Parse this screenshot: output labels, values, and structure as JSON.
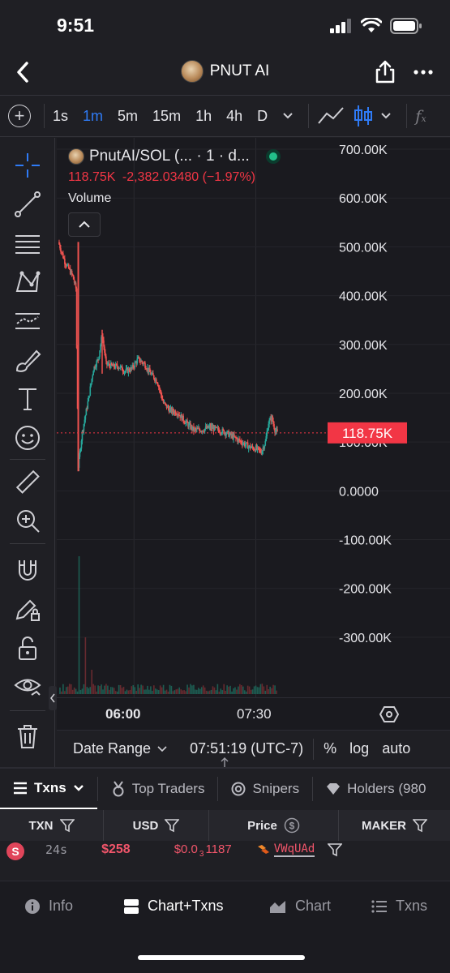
{
  "status": {
    "time": "9:51"
  },
  "nav": {
    "title": "PNUT AI"
  },
  "toolbar": {
    "intervals": [
      "1s",
      "1m",
      "5m",
      "15m",
      "1h",
      "4h",
      "D"
    ],
    "active_interval": "1m"
  },
  "legend": {
    "symbol": "PnutAI/SOL (... · 1 · d...",
    "price": "118.75K",
    "change": "-2,382.03480 (−1.97%)",
    "volume_label": "Volume"
  },
  "chart_data": {
    "type": "candlestick",
    "title": "PnutAI/SOL",
    "y_ticks": [
      "700.00K",
      "600.00K",
      "500.00K",
      "400.00K",
      "300.00K",
      "200.00K",
      "100.00K",
      "0.0000",
      "-100.00K",
      "-200.00K",
      "-300.00K"
    ],
    "ylim": [
      -350000,
      710000
    ],
    "x_ticks": [
      "06:00",
      "07:30"
    ],
    "last_price": 118750,
    "last_price_label": "118.75K",
    "price_path": [
      [
        0,
        510000
      ],
      [
        8,
        470000
      ],
      [
        18,
        440000
      ],
      [
        22,
        415000
      ],
      [
        25,
        50000
      ],
      [
        30,
        120000
      ],
      [
        38,
        190000
      ],
      [
        44,
        250000
      ],
      [
        50,
        270000
      ],
      [
        55,
        320000
      ],
      [
        60,
        260000
      ],
      [
        68,
        255000
      ],
      [
        76,
        255000
      ],
      [
        84,
        245000
      ],
      [
        92,
        250000
      ],
      [
        100,
        270000
      ],
      [
        108,
        260000
      ],
      [
        116,
        240000
      ],
      [
        124,
        225000
      ],
      [
        132,
        180000
      ],
      [
        140,
        165000
      ],
      [
        150,
        160000
      ],
      [
        160,
        140000
      ],
      [
        170,
        125000
      ],
      [
        180,
        125000
      ],
      [
        190,
        130000
      ],
      [
        200,
        125000
      ],
      [
        210,
        120000
      ],
      [
        220,
        110000
      ],
      [
        230,
        100000
      ],
      [
        240,
        90000
      ],
      [
        250,
        85000
      ],
      [
        255,
        80000
      ],
      [
        260,
        100000
      ],
      [
        264,
        140000
      ],
      [
        268,
        150000
      ],
      [
        272,
        125000
      ],
      [
        275,
        118750
      ]
    ],
    "colors": {
      "up": "#26a69a",
      "down": "#ef5350",
      "price_line": "#f23645"
    },
    "grid": true
  },
  "range_bar": {
    "date_range": "Date Range",
    "time": "07:51:19 (UTC-7)",
    "percent": "%",
    "log": "log",
    "auto": "auto"
  },
  "tabs": [
    {
      "label": "Txns"
    },
    {
      "label": "Top Traders"
    },
    {
      "label": "Snipers"
    },
    {
      "label": "Holders (980"
    }
  ],
  "columns": [
    "TXN",
    "USD",
    "Price",
    "MAKER"
  ],
  "txn": {
    "type": "S",
    "age": "24s",
    "usd": "$258",
    "price_prefix": "$0.0",
    "price_sub": "3",
    "price_suffix": "1187",
    "maker": "VWqUAd"
  },
  "bottom_nav": [
    {
      "label": "Info"
    },
    {
      "label": "Chart+Txns"
    },
    {
      "label": "Chart"
    },
    {
      "label": "Txns"
    }
  ]
}
